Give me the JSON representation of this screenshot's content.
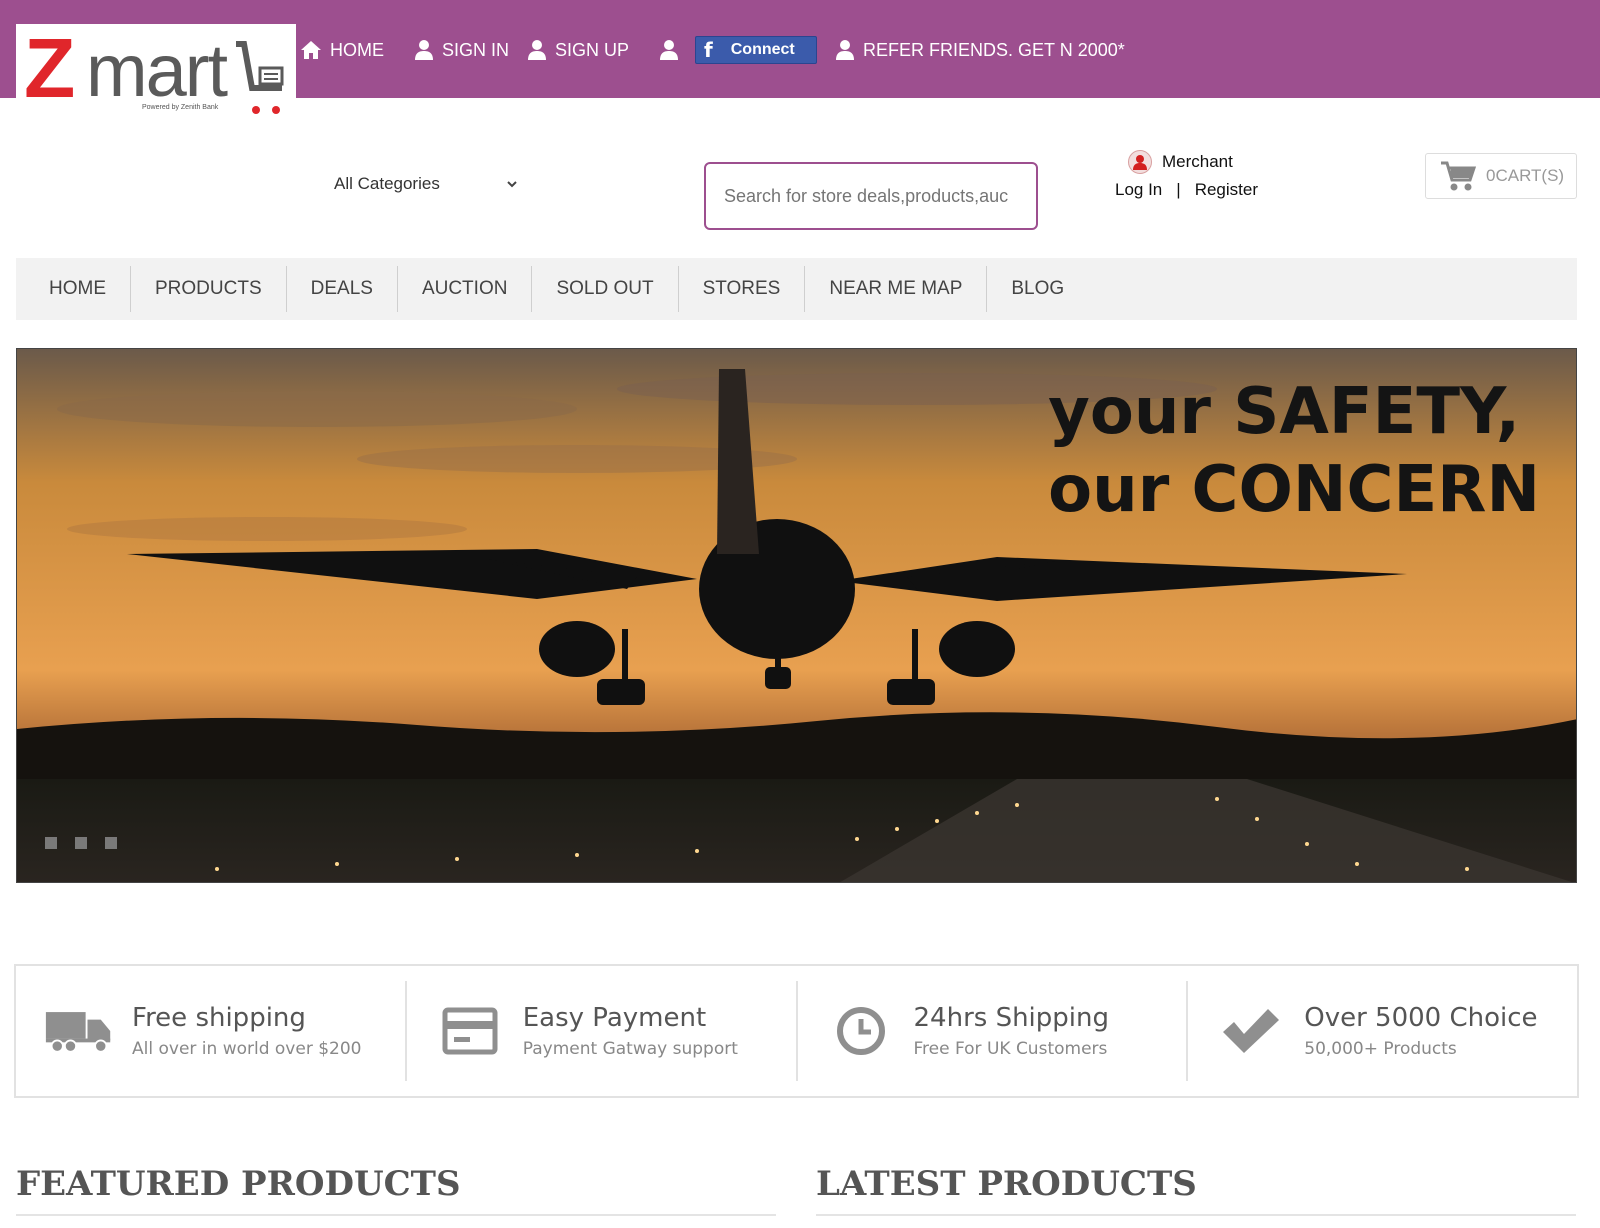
{
  "header": {
    "logo": {
      "text_main": "Z",
      "text_rest": "mart",
      "powered_by": "Powered by Zenith Bank"
    },
    "top_nav": {
      "home": "HOME",
      "sign_in": "SIGN IN",
      "sign_up": "SIGN UP",
      "facebook_connect": "Connect",
      "refer": "REFER FRIENDS. GET N 2000*"
    },
    "category_select": "All Categories",
    "search_placeholder": "Search for store deals,products,auc",
    "merchant": {
      "label": "Merchant",
      "login": "Log In",
      "separator": "|",
      "register": "Register"
    },
    "cart": {
      "label": "0CART(S)"
    }
  },
  "main_nav": [
    "HOME",
    "PRODUCTS",
    "DEALS",
    "AUCTION",
    "SOLD OUT",
    "STORES",
    "NEAR ME MAP",
    "BLOG"
  ],
  "banner": {
    "line1": "your SAFETY,",
    "line2": "our CONCERN",
    "slide_count": 3
  },
  "features": [
    {
      "icon": "truck-icon",
      "title": "Free shipping",
      "subtitle": "All over in world over $200"
    },
    {
      "icon": "credit-card-icon",
      "title": "Easy Payment",
      "subtitle": "Payment Gatway support"
    },
    {
      "icon": "clock-icon",
      "title": "24hrs Shipping",
      "subtitle": "Free For UK Customers"
    },
    {
      "icon": "checkmark-icon",
      "title": "Over 5000 Choice",
      "subtitle": "50,000+ Products"
    }
  ],
  "sections": {
    "featured": "FEATURED PRODUCTS",
    "latest": "LATEST PRODUCTS"
  },
  "colors": {
    "brand_purple": "#9d4f8f",
    "logo_red": "#e0262b",
    "facebook_blue": "#3b5bab"
  }
}
